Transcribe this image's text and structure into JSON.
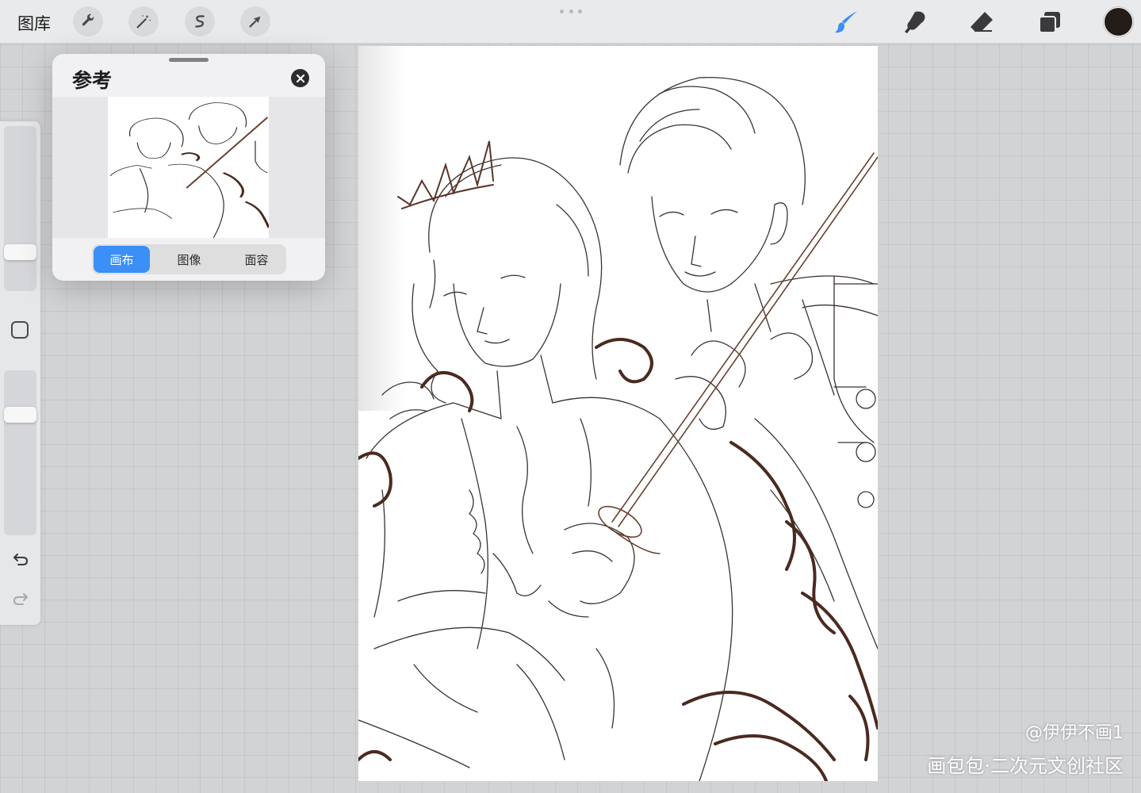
{
  "topbar": {
    "gallery_label": "图库",
    "left_tools": [
      {
        "name": "actions",
        "icon": "wrench-icon"
      },
      {
        "name": "adjustments",
        "icon": "magic-wand-icon"
      },
      {
        "name": "selection",
        "icon": "selection-s-icon"
      },
      {
        "name": "transform",
        "icon": "arrow-cursor-icon"
      }
    ],
    "right_tools": [
      {
        "name": "brush",
        "icon": "brush-icon",
        "active": true
      },
      {
        "name": "smudge",
        "icon": "smudge-icon"
      },
      {
        "name": "eraser",
        "icon": "eraser-icon"
      },
      {
        "name": "layers",
        "icon": "layers-icon"
      }
    ],
    "current_color": "#231c17",
    "accent_color": "#3b8ff7"
  },
  "sidebar": {
    "brush_size_level": 0.18,
    "opacity_level": 0.78,
    "icons": [
      "square-modify-icon",
      "undo-icon",
      "redo-icon"
    ]
  },
  "reference_panel": {
    "title": "参考",
    "close_icon": "close-icon",
    "tabs": [
      {
        "label": "画布",
        "active": true
      },
      {
        "label": "图像",
        "active": false
      },
      {
        "label": "面容",
        "active": false
      }
    ]
  },
  "watermark": {
    "user": "@伊伊不画1",
    "site": "画包包·二次元文创社区"
  }
}
